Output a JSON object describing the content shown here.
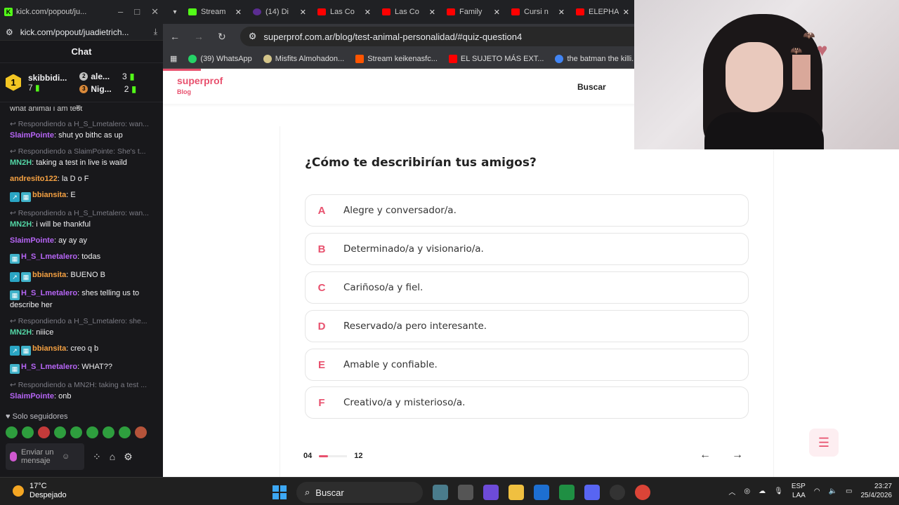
{
  "chat_window": {
    "title": "kick.com/popout/ju...",
    "url": "kick.com/popout/juadietrich...",
    "header": "Chat",
    "leaders": [
      {
        "rank": "1",
        "name": "skibbidi...",
        "count": "7"
      },
      {
        "rank": "2",
        "name": "ale...",
        "count": "3"
      },
      {
        "rank": "3",
        "name": "Nig...",
        "count": "2"
      }
    ],
    "partial_top": "what animal i am  test",
    "messages": [
      {
        "reply": "Respondiendo a H_S_Lmetalero: wan...",
        "user": "SlaimPointe",
        "color": "#b665f5",
        "badges": false,
        "text": ": shut yo bithc as up"
      },
      {
        "reply": "Respondiendo a SlaimPointe: She's t...",
        "user": "MN2H",
        "color": "#53d6a5",
        "badges": false,
        "text": ": taking a test in live is waild"
      },
      {
        "reply": "",
        "user": "andresito122",
        "color": "#f5a142",
        "badges": false,
        "text": ": la D o F"
      },
      {
        "reply": "",
        "user": "bbiansita",
        "color": "#f5a142",
        "badges": true,
        "text": ": E"
      },
      {
        "reply": "Respondiendo a H_S_Lmetalero: wan...",
        "user": "MN2H",
        "color": "#53d6a5",
        "badges": false,
        "text": ": i will be thankful"
      },
      {
        "reply": "",
        "user": "SlaimPointe",
        "color": "#b665f5",
        "badges": false,
        "text": ": ay ay ay"
      },
      {
        "reply": "",
        "user": "H_S_Lmetalero",
        "color": "#b665f5",
        "badges": "single",
        "text": ": todas"
      },
      {
        "reply": "",
        "user": "bbiansita",
        "color": "#f5a142",
        "badges": true,
        "text": ": BUENO B"
      },
      {
        "reply": "",
        "user": "H_S_Lmetalero",
        "color": "#b665f5",
        "badges": "single",
        "text": ": shes telling us to describe her"
      },
      {
        "reply": "Respondiendo a H_S_Lmetalero: she...",
        "user": "MN2H",
        "color": "#53d6a5",
        "badges": false,
        "text": ": niiice"
      },
      {
        "reply": "",
        "user": "bbiansita",
        "color": "#f5a142",
        "badges": true,
        "text": ": creo q b"
      },
      {
        "reply": "",
        "user": "H_S_Lmetalero",
        "color": "#b665f5",
        "badges": "single",
        "text": ": WHAT??"
      },
      {
        "reply": "Respondiendo a MN2H: taking a test ...",
        "user": "SlaimPointe",
        "color": "#b665f5",
        "badges": false,
        "text": ": onb"
      }
    ],
    "followers_label": "Solo seguidores",
    "input_placeholder": "Enviar un mensaje"
  },
  "browser": {
    "tabs": [
      {
        "title": "Stream",
        "icon": "kick"
      },
      {
        "title": "(14) Di",
        "icon": "discord"
      },
      {
        "title": "Las Co",
        "icon": "youtube"
      },
      {
        "title": "Las Co",
        "icon": "youtube"
      },
      {
        "title": "Family",
        "icon": "youtube"
      },
      {
        "title": "Cursi n",
        "icon": "youtube"
      },
      {
        "title": "ELEPHA",
        "icon": "youtube"
      }
    ],
    "url": "superprof.com.ar/blog/test-animal-personalidad/#quiz-question4",
    "bookmarks": [
      {
        "label": "(39) WhatsApp",
        "icon": "wa"
      },
      {
        "label": "Misfits Almohadon...",
        "icon": "ms"
      },
      {
        "label": "Stream keikenasfc...",
        "icon": "sc"
      },
      {
        "label": "EL SUJETO MÁS EXT...",
        "icon": "yt"
      },
      {
        "label": "the batman the killi...",
        "icon": "go"
      }
    ]
  },
  "site": {
    "logo": "superprof",
    "logo_sub": "Blog",
    "search_label": "Buscar"
  },
  "quiz": {
    "question": "¿Cómo te describirían tus amigos?",
    "options": [
      {
        "letter": "A",
        "text": "Alegre y conversador/a."
      },
      {
        "letter": "B",
        "text": "Determinado/a y visionario/a."
      },
      {
        "letter": "C",
        "text": "Cariñoso/a y fiel."
      },
      {
        "letter": "D",
        "text": "Reservado/a pero interesante."
      },
      {
        "letter": "E",
        "text": "Amable y confiable."
      },
      {
        "letter": "F",
        "text": "Creativo/a y misterioso/a."
      }
    ],
    "current": "04",
    "total": "12",
    "progress_fraction": 0.33
  },
  "taskbar": {
    "temp": "17°C",
    "weather": "Despejado",
    "search": "Buscar",
    "lang": "ESP",
    "lang2": "LAA",
    "time": "23:27",
    "date": "25/4/2026"
  },
  "colors": {
    "accent": "#e8516e",
    "kick_green": "#53fc18"
  }
}
